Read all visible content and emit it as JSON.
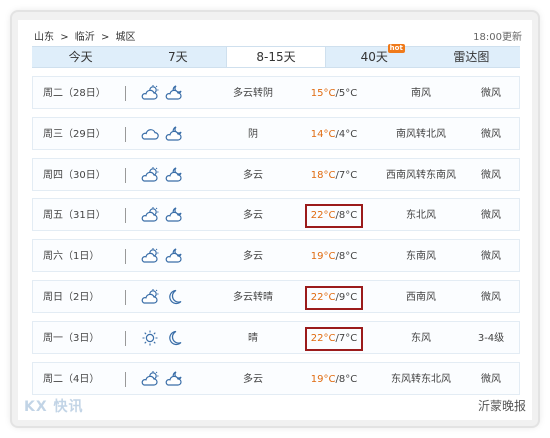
{
  "breadcrumb": [
    "山东",
    ">",
    "临沂",
    ">",
    "城区"
  ],
  "updated": "18:00更新",
  "tabs": [
    {
      "label": "今天"
    },
    {
      "label": "7天"
    },
    {
      "label": "8-15天"
    },
    {
      "label": "40天",
      "badge": "hot"
    },
    {
      "label": "雷达图"
    }
  ],
  "active_tab": "8-15天",
  "days": [
    {
      "date": "周二（28日）",
      "icon1": "partly-cloudy-day",
      "icon2": "partly-cloudy-night",
      "desc": "多云转阴",
      "hi": "15°C",
      "lo": "/5°C",
      "wind": "南风",
      "force": "微风",
      "highlight": false
    },
    {
      "date": "周三（29日）",
      "icon1": "cloudy",
      "icon2": "partly-cloudy-night",
      "desc": "阴",
      "hi": "14°C",
      "lo": "/4°C",
      "wind": "南风转北风",
      "force": "微风",
      "highlight": false
    },
    {
      "date": "周四（30日）",
      "icon1": "partly-cloudy-day",
      "icon2": "partly-cloudy-night",
      "desc": "多云",
      "hi": "18°C",
      "lo": "/7°C",
      "wind": "西南风转东南风",
      "force": "微风",
      "highlight": false
    },
    {
      "date": "周五（31日）",
      "icon1": "partly-cloudy-day",
      "icon2": "partly-cloudy-night",
      "desc": "多云",
      "hi": "22°C",
      "lo": "/8°C",
      "wind": "东北风",
      "force": "微风",
      "highlight": true
    },
    {
      "date": "周六（1日）",
      "icon1": "partly-cloudy-day",
      "icon2": "partly-cloudy-night",
      "desc": "多云",
      "hi": "19°C",
      "lo": "/8°C",
      "wind": "东南风",
      "force": "微风",
      "highlight": false
    },
    {
      "date": "周日（2日）",
      "icon1": "partly-cloudy-day",
      "icon2": "moon",
      "desc": "多云转晴",
      "hi": "22°C",
      "lo": "/9°C",
      "wind": "西南风",
      "force": "微风",
      "highlight": true
    },
    {
      "date": "周一（3日）",
      "icon1": "sun",
      "icon2": "moon",
      "desc": "晴",
      "hi": "22°C",
      "lo": "/7°C",
      "wind": "东风",
      "force": "3-4级",
      "highlight": true
    },
    {
      "date": "周二（4日）",
      "icon1": "partly-cloudy-day",
      "icon2": "partly-cloudy-night",
      "desc": "多云",
      "hi": "19°C",
      "lo": "/8°C",
      "wind": "东风转东北风",
      "force": "微风",
      "highlight": false
    }
  ],
  "watermark_left": "KX 快讯",
  "watermark_right": "沂蒙晚报",
  "colors": {
    "accent_temp": "#e06b10",
    "highlight_border": "#9b1b1b",
    "tab_bg": "#dfeefa"
  }
}
